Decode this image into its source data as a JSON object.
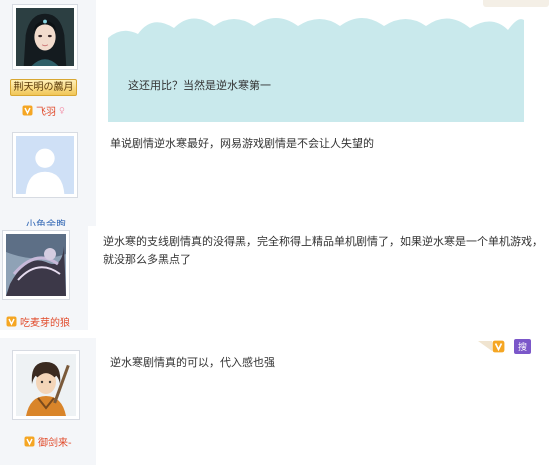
{
  "posts": [
    {
      "user": {
        "name": "飞羽",
        "title_badge": "荆天明の薦月",
        "avatar_icon": "female-character-avatar-icon",
        "gender_icon": "female-gender-icon"
      },
      "content": "这还用比？当然是逆水寒第一"
    },
    {
      "user": {
        "name": "小鱼余煦",
        "avatar_icon": "default-avatar-icon"
      },
      "content": "单说剧情逆水寒最好，网易游戏剧情是不会让人失望的"
    },
    {
      "user": {
        "name": "吃麦芽的狼",
        "avatar_icon": "scenery-avatar-icon"
      },
      "content_lines": [
        "逆水寒的支线剧情真的没得黑，完全称得上精品单机剧情了，如果逆水寒是一个单机游戏，",
        "就没那么多黑点了"
      ]
    },
    {
      "user": {
        "name": "御剑来-",
        "avatar_icon": "male-swordsman-avatar-icon"
      },
      "content": "逆水寒剧情真的可以，代入感也强",
      "corner_label": "搜"
    }
  ],
  "colors": {
    "bubble": "#c9e9ec",
    "sidebar": "#f4f6f9",
    "name_red": "#e14a2a",
    "name_blue": "#2d64b3",
    "vip": "#f5a623"
  }
}
